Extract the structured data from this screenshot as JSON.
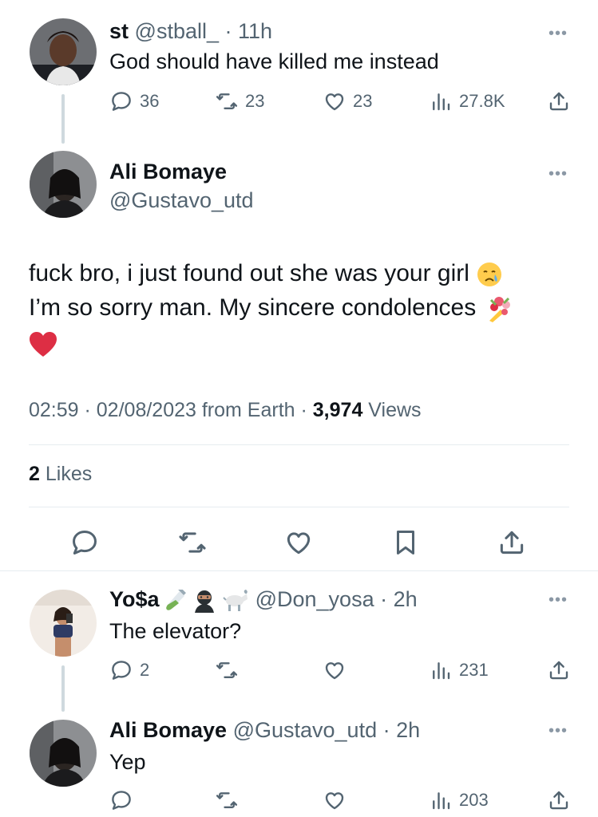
{
  "tweet1": {
    "name": "st",
    "handle": "@stball_",
    "sep": " · ",
    "time": "11h",
    "text": "God should have killed me instead",
    "replies": "36",
    "retweets": "23",
    "likes": "23",
    "views": "27.8K"
  },
  "main": {
    "name": "Ali Bomaye",
    "handle": "@Gustavo_utd",
    "line1": "fuck bro, i just found out she was your girl",
    "line2": "I’m so sorry man. My sincere condolences",
    "time": "02:59",
    "date": "02/08/2023",
    "source": "from Earth",
    "views_count": "3,974",
    "views_label": "Views",
    "likes_count": "2",
    "likes_label": "Likes"
  },
  "reply1": {
    "name": "Yo$a",
    "handle": "@Don_yosa",
    "sep": " · ",
    "time": "2h",
    "text": "The elevator?",
    "replies": "2",
    "views": "231"
  },
  "reply2": {
    "name": "Ali Bomaye",
    "handle": "@Gustavo_utd",
    "sep": " · ",
    "time": "2h",
    "text": "Yep",
    "views": "203"
  },
  "more_label": "•••",
  "colors": {
    "muted": "#536471",
    "text": "#0f1419",
    "divider": "#e6ecf0",
    "heart": "#e0245e"
  }
}
